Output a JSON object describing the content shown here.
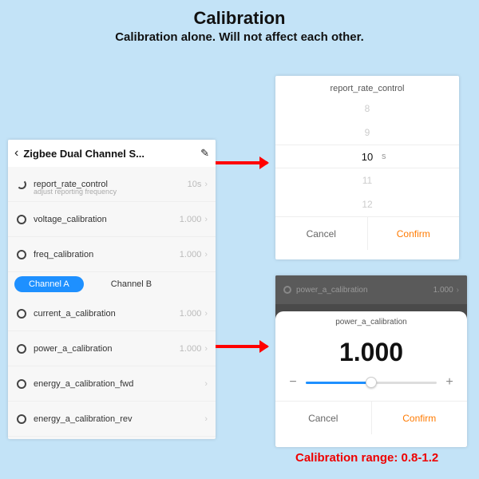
{
  "page": {
    "title": "Calibration",
    "subtitle": "Calibration alone. Will not affect each other."
  },
  "left": {
    "header_title": "Zigbee Dual Channel S...",
    "rows": {
      "report": {
        "label": "report_rate_control",
        "sub": "adjust reporting frequency",
        "val": "10s"
      },
      "voltage": {
        "label": "voltage_calibration",
        "val": "1.000"
      },
      "freq": {
        "label": "freq_calibration",
        "val": "1.000"
      },
      "current_a": {
        "label": "current_a_calibration",
        "val": "1.000"
      },
      "power_a": {
        "label": "power_a_calibration",
        "val": "1.000"
      },
      "energy_a_fwd": {
        "label": "energy_a_calibration_fwd"
      },
      "energy_a_rev": {
        "label": "energy_a_calibration_rev"
      }
    },
    "tabs": {
      "a": "Channel A",
      "b": "Channel B"
    }
  },
  "picker": {
    "title": "report_rate_control",
    "opt0": "8",
    "opt1": "9",
    "sel": "10",
    "unit": "s",
    "opt3": "11",
    "opt4": "12",
    "cancel": "Cancel",
    "confirm": "Confirm"
  },
  "sheet": {
    "dim_label": "power_a_calibration",
    "dim_val": "1.000",
    "title": "power_a_calibration",
    "value": "1.000",
    "cancel": "Cancel",
    "confirm": "Confirm"
  },
  "range_note": "Calibration range: 0.8-1.2"
}
